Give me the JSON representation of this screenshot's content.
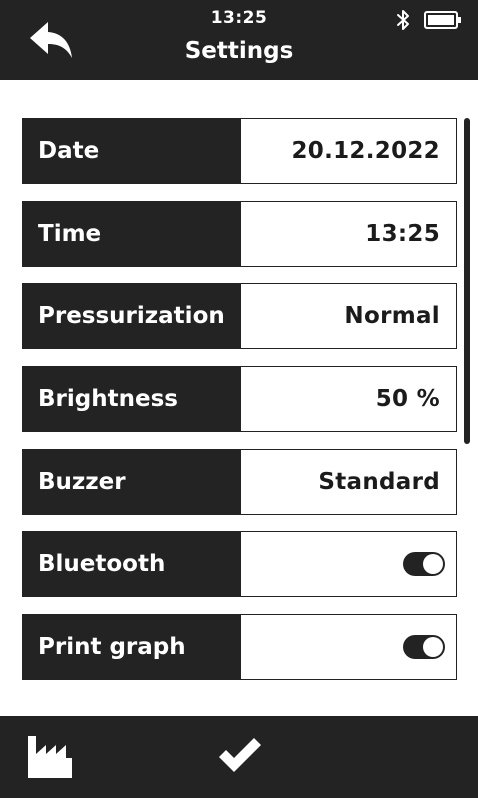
{
  "status": {
    "time": "13:25"
  },
  "header": {
    "title": "Settings"
  },
  "settings": [
    {
      "label": "Date",
      "value": "20.12.2022"
    },
    {
      "label": "Time",
      "value": "13:25"
    },
    {
      "label": "Pressurization",
      "value": "Normal"
    },
    {
      "label": "Brightness",
      "value": "50 %"
    },
    {
      "label": "Buzzer",
      "value": "Standard"
    },
    {
      "label": "Bluetooth",
      "toggle": true
    },
    {
      "label": "Print graph",
      "toggle": true
    }
  ],
  "icons": {
    "back": "back-arrow-icon",
    "bluetooth": "bluetooth-icon",
    "battery": "battery-icon",
    "factory": "factory-icon",
    "confirm": "checkmark-icon"
  },
  "colors": {
    "dark": "#232323",
    "light": "#ffffff"
  }
}
